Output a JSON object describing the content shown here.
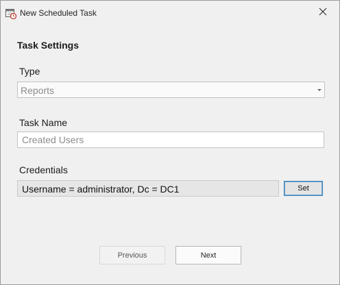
{
  "window": {
    "title": "New Scheduled Task",
    "icon": "calendar-clock-icon",
    "close_icon": "close-icon"
  },
  "section": {
    "title": "Task Settings"
  },
  "type_field": {
    "label": "Type",
    "value": "Reports",
    "arrow_icon": "chevron-down-icon"
  },
  "task_name_field": {
    "label": "Task Name",
    "value": "",
    "placeholder": "Created Users"
  },
  "credentials_field": {
    "label": "Credentials",
    "value": "Username = administrator, Dc = DC1",
    "set_label": "Set"
  },
  "footer": {
    "previous_label": "Previous",
    "next_label": "Next"
  },
  "colors": {
    "background": "#f0f0f0",
    "focus_border": "#3c7fb1",
    "icon_accent": "#c0392b"
  }
}
